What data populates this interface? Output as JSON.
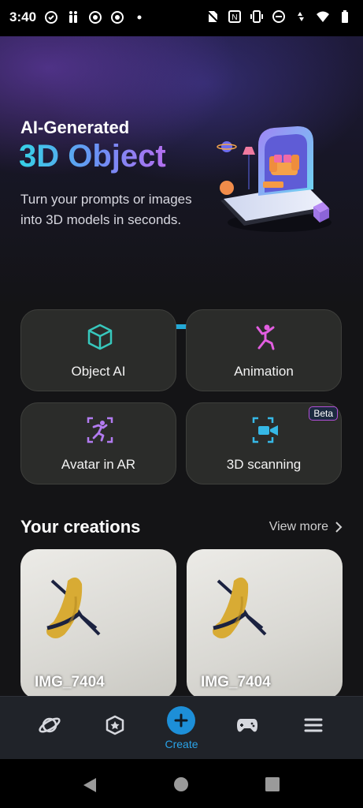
{
  "status_bar": {
    "time": "3:40",
    "left_icons": [
      "sync-icon",
      "accessibility-icon",
      "chrome-icon",
      "chrome-icon",
      "dot-icon"
    ],
    "right_icons": [
      "no-sim-icon",
      "nfc-icon",
      "vibrate-icon",
      "dnd-icon",
      "data-icon",
      "wifi-icon",
      "battery-icon"
    ]
  },
  "hero": {
    "title_line1": "AI-Generated",
    "title_line2": "3D Object",
    "description": "Turn your prompts or images into 3D models in seconds.",
    "carousel_index": 1,
    "carousel_total": 2
  },
  "features": [
    {
      "label": "Object AI",
      "icon": "cube-icon",
      "color": "#37c8bd"
    },
    {
      "label": "Animation",
      "icon": "dancing-figure-icon",
      "color": "#e25ee0"
    },
    {
      "label": "Avatar in AR",
      "icon": "ar-running-figure-icon",
      "color": "#b27bf0"
    },
    {
      "label": "3D scanning",
      "icon": "video-scan-icon",
      "color": "#36b8e6",
      "badge": "Beta"
    }
  ],
  "creations": {
    "title": "Your creations",
    "view_more": "View more",
    "items": [
      {
        "name": "IMG_7404"
      },
      {
        "name": "IMG_7404"
      }
    ]
  },
  "bottom_nav": {
    "items": [
      "explore-icon",
      "badge-icon",
      "create-icon",
      "game-controller-icon",
      "menu-icon"
    ],
    "create_label": "Create",
    "accent": "#2aa3e8"
  },
  "system_nav": [
    "back-icon",
    "home-icon",
    "recents-icon"
  ]
}
